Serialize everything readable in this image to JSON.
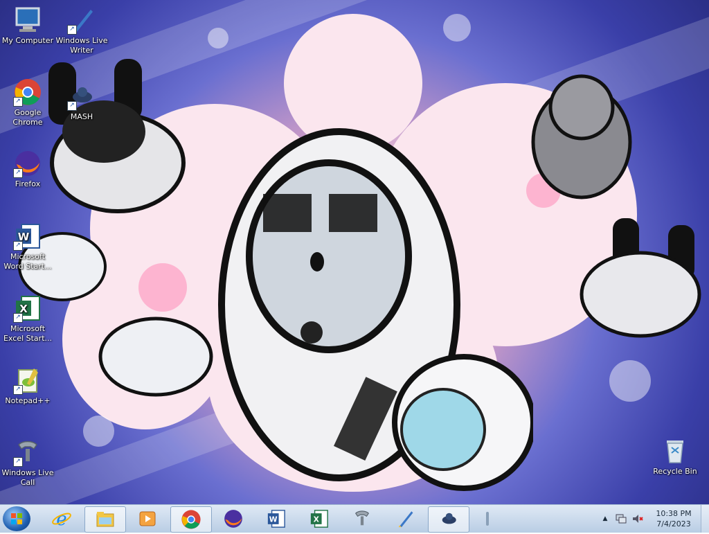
{
  "desktop": {
    "icons": [
      {
        "label": "My Computer",
        "icon": "computer-icon"
      },
      {
        "label": "Windows Live Writer",
        "icon": "writer-icon"
      },
      {
        "label": "MASH",
        "icon": "mash-icon"
      },
      {
        "label": "Google Chrome",
        "icon": "chrome-icon"
      },
      {
        "label": "Firefox",
        "icon": "firefox-icon"
      },
      {
        "label": "Microsoft Word Start...",
        "icon": "word-icon"
      },
      {
        "label": "Microsoft Excel Start...",
        "icon": "excel-icon"
      },
      {
        "label": "Notepad++",
        "icon": "notepadpp-icon"
      },
      {
        "label": "Windows Live Call",
        "icon": "phone-icon"
      },
      {
        "label": "Recycle Bin",
        "icon": "recycle-bin-icon"
      }
    ]
  },
  "taskbar": {
    "items": [
      {
        "icon": "ie-icon"
      },
      {
        "icon": "explorer-icon"
      },
      {
        "icon": "media-player-icon"
      },
      {
        "icon": "chrome-icon"
      },
      {
        "icon": "firefox-icon"
      },
      {
        "icon": "word-icon"
      },
      {
        "icon": "excel-icon"
      },
      {
        "icon": "phone-icon"
      },
      {
        "icon": "writer-icon"
      },
      {
        "icon": "mash-icon"
      }
    ],
    "tray_chevron": "▲",
    "clock": {
      "time": "10:38 PM",
      "date": "7/4/2023"
    }
  },
  "colors": {
    "taskbar": "#c9d9ec",
    "desktop_blue": "#3a3fa8",
    "desktop_pink": "#f7c7d8"
  }
}
